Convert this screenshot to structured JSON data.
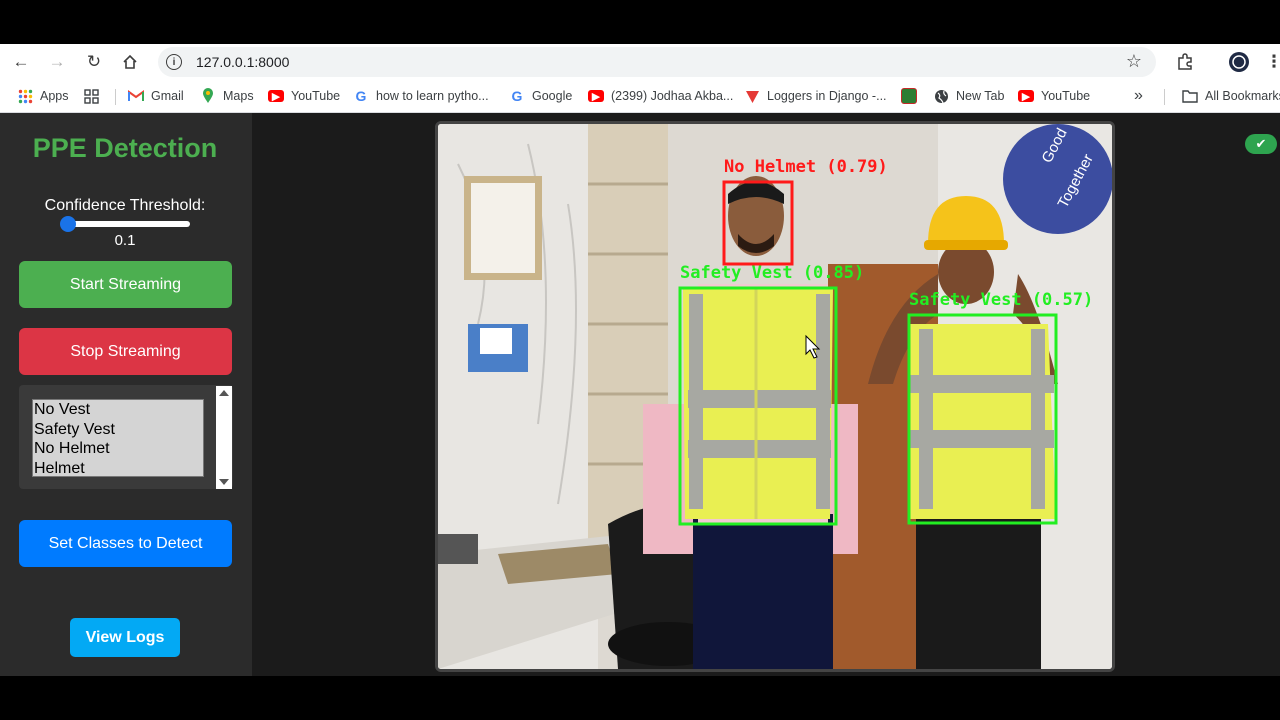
{
  "browser": {
    "url": "127.0.0.1:8000",
    "bookmarks": [
      {
        "label": "Apps",
        "icon": "apps-grid-icon"
      },
      {
        "label": "",
        "icon": "grid-icon"
      },
      {
        "label": "Gmail",
        "icon": "gmail-icon"
      },
      {
        "label": "Maps",
        "icon": "maps-pin-icon"
      },
      {
        "label": "YouTube",
        "icon": "youtube-icon"
      },
      {
        "label": "how to learn pytho...",
        "icon": "google-icon"
      },
      {
        "label": "Google",
        "icon": "google-icon"
      },
      {
        "label": "(2399) Jodhaa Akba...",
        "icon": "youtube-icon"
      },
      {
        "label": "Loggers in Django -...",
        "icon": "triangle-icon"
      },
      {
        "label": "",
        "icon": "bookmark-favicon"
      },
      {
        "label": "New Tab",
        "icon": "globe-icon"
      },
      {
        "label": "YouTube",
        "icon": "youtube-icon"
      },
      {
        "label": "All Bookmarks",
        "icon": "folder-icon"
      }
    ]
  },
  "sidebar": {
    "title": "PPE Detection",
    "threshold_label": "Confidence Threshold:",
    "threshold_value": "0.1",
    "threshold_fraction": 0.0,
    "start_button": "Start Streaming",
    "stop_button": "Stop Streaming",
    "classes": [
      "No Vest",
      "Safety Vest",
      "No Helmet",
      "Helmet"
    ],
    "set_classes_button": "Set Classes to Detect",
    "logs_button": "View Logs"
  },
  "video": {
    "detections": [
      {
        "label": "No Helmet (0.79)",
        "color": "#ff1a1a"
      },
      {
        "label": "Safety Vest (0.85)",
        "color": "#22ee22"
      },
      {
        "label": "Safety Vest (0.57)",
        "color": "#22ee22"
      }
    ],
    "sign_text": [
      "Good",
      "Together"
    ]
  },
  "colors": {
    "title_green": "#4caf50",
    "start_green": "#4caf50",
    "stop_red": "#dc3545",
    "set_blue": "#007bff",
    "logs_blue": "#03a9f4",
    "slider_blue": "#1a73e8"
  }
}
